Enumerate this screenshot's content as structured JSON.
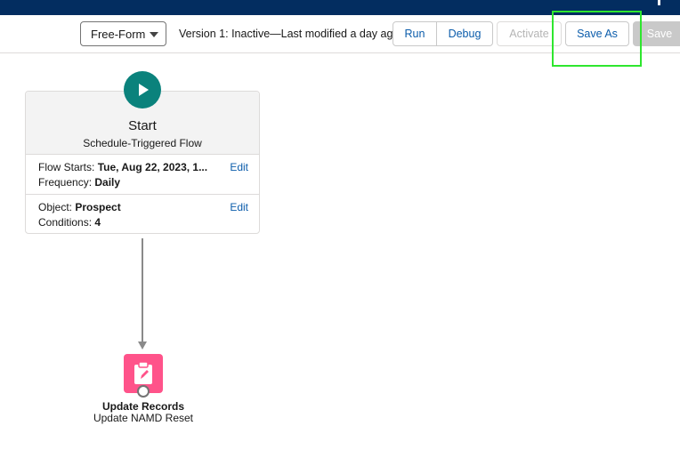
{
  "toolbar": {
    "layout_select": {
      "value": "Free-Form"
    },
    "version_text": "Version 1: Inactive—Last modified a day ago",
    "run_label": "Run",
    "debug_label": "Debug",
    "activate_label": "Activate",
    "save_as_label": "Save As",
    "save_label": "Save"
  },
  "start_node": {
    "icon": "play-icon",
    "icon_color": "#0b827c",
    "title": "Start",
    "subtitle": "Schedule-Triggered Flow",
    "sections": [
      {
        "rows": [
          {
            "label": "Flow Starts:",
            "value": "Tue, Aug 22, 2023, 1..."
          },
          {
            "label": "Frequency:",
            "value": "Daily"
          }
        ],
        "edit_label": "Edit"
      },
      {
        "rows": [
          {
            "label": "Object:",
            "value": "Prospect"
          },
          {
            "label": "Conditions:",
            "value": "4"
          }
        ],
        "edit_label": "Edit"
      }
    ]
  },
  "update_node": {
    "icon": "clipboard-edit-icon",
    "icon_color": "#ff538a",
    "title": "Update Records",
    "subtitle": "Update NAMD Reset"
  },
  "colors": {
    "header_bg": "#032d60",
    "link": "#0b5cab",
    "highlight": "#2ee62e"
  }
}
